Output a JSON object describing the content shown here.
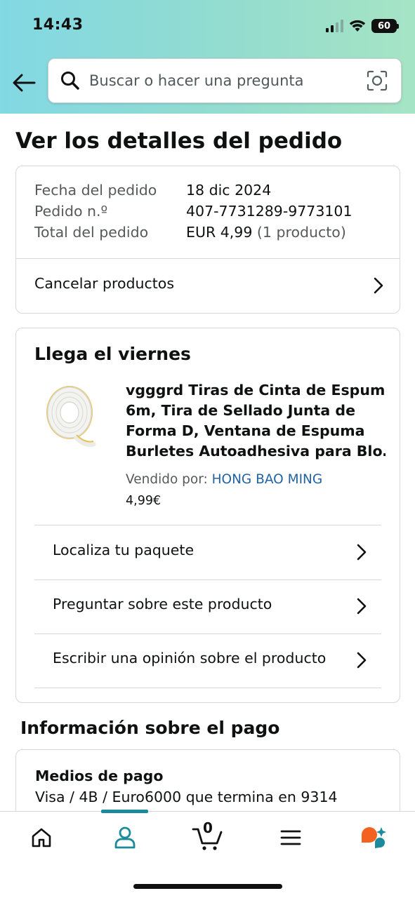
{
  "status_bar": {
    "time": "14:43",
    "battery_level": "60",
    "signal-icon": "signal-icon",
    "wifi_icon": "wifi-icon"
  },
  "search": {
    "placeholder": "Buscar o hacer una pregunta",
    "icon": "search-icon",
    "camera_icon": "camera-icon"
  },
  "page_title": "Ver los detalles del pedido",
  "order_summary": {
    "rows": [
      {
        "label": "Fecha del pedido",
        "value": "18 dic 2024",
        "extra": ""
      },
      {
        "label": "Pedido n.º",
        "value": "407-7731289-9773101",
        "extra": ""
      },
      {
        "label": "Total del pedido",
        "value": "EUR 4,99",
        "extra": "(1 producto)"
      }
    ],
    "cancel_label": "Cancelar productos"
  },
  "shipment": {
    "heading": "Llega el viernes",
    "product": {
      "title_lines": [
        "vgggrd Tiras de Cinta de Espuma",
        "6m, Tira de Sellado Junta de",
        "Forma D, Ventana de Espuma",
        "Burletes Autoadhesiva para Blo…"
      ],
      "seller_prefix": "Vendido por:",
      "seller_name": "HONG BAO MING",
      "price": "4,99€"
    },
    "actions": [
      "Localiza tu paquete",
      "Preguntar sobre este producto",
      "Escribir una opinión sobre el producto"
    ]
  },
  "payment": {
    "heading": "Información sobre el pago",
    "methods_title": "Medios de pago",
    "method_value": "Visa / 4B / Euro6000  que termina en 9314"
  },
  "tabbar": {
    "tabs": [
      "home-icon",
      "account-icon",
      "cart-icon",
      "menu-icon",
      "rufus-assistant-icon"
    ],
    "cart_count": "0",
    "active_color": "#1a8a9c"
  },
  "colors": {
    "link": "#2162a1",
    "header_gradient_start": "#82d8e3",
    "header_gradient_end": "#a6e4c4"
  }
}
